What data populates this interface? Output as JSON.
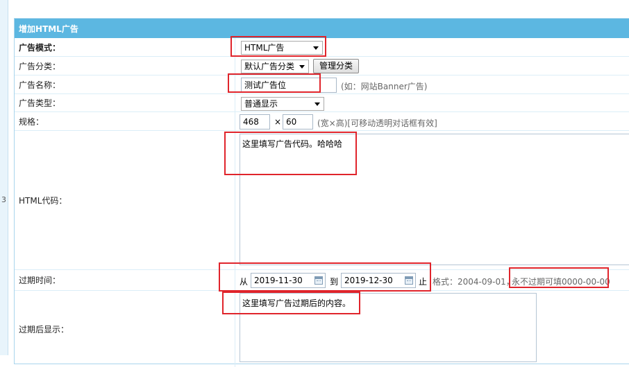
{
  "side": {
    "line_number": "3"
  },
  "panel": {
    "title": "增加HTML广告"
  },
  "form": {
    "mode": {
      "label": "广告模式：",
      "value": "HTML广告"
    },
    "category": {
      "label": "广告分类：",
      "value": "默认广告分类",
      "manage_button": "管理分类"
    },
    "name": {
      "label": "广告名称：",
      "value": "测试广告位",
      "hint": "(如：网站Banner广告)"
    },
    "type": {
      "label": "广告类型：",
      "value": "普通显示"
    },
    "size": {
      "label": "规格：",
      "width": "468",
      "times": "×",
      "height": "60",
      "hint": "(宽×高)[可移动透明对话框有效]"
    },
    "html_code": {
      "label": "HTML代码：",
      "value": "这里填写广告代码。哈哈哈"
    },
    "expire": {
      "label": "过期时间：",
      "from_label": "从",
      "from_date": "2019-11-30",
      "to_label": "到",
      "to_date": "2019-12-30",
      "end_label": "止",
      "format_hint": "格式：2004-09-01，",
      "never_hint": "永不过期可填0000-00-00"
    },
    "after_expire": {
      "label": "过期后显示：",
      "value": "这里填写广告过期后的内容。"
    }
  }
}
